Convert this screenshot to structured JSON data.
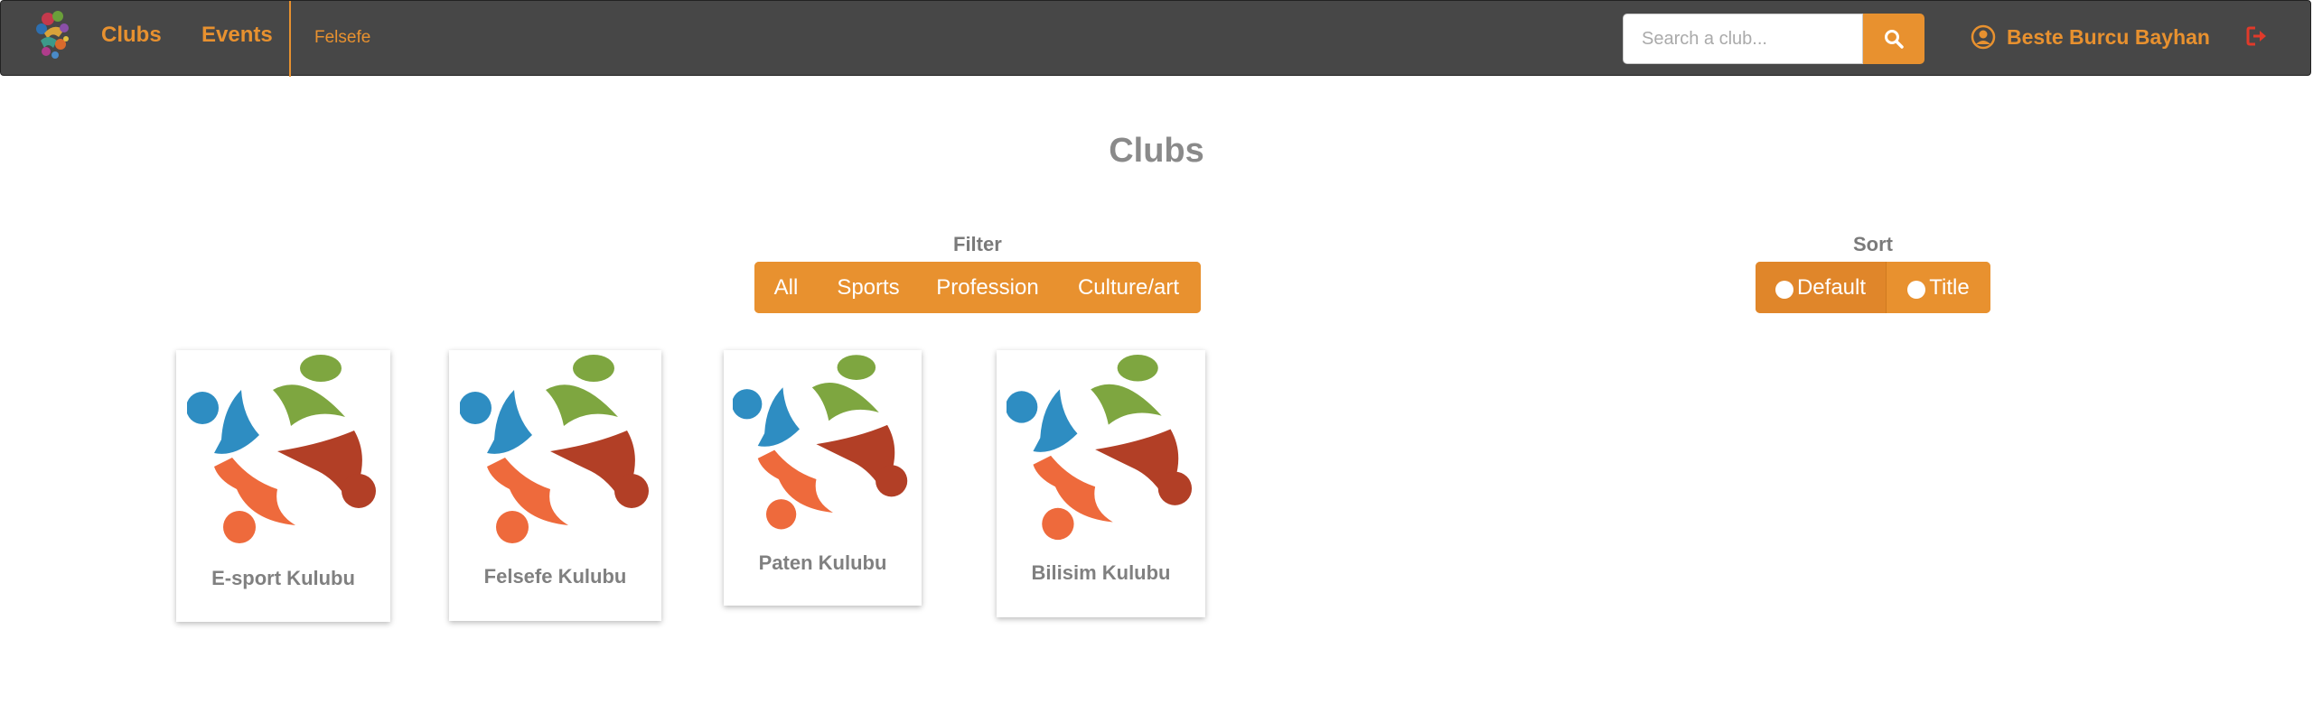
{
  "navbar": {
    "links": {
      "clubs": "Clubs",
      "events": "Events",
      "current": "Felsefe"
    },
    "search": {
      "placeholder": "Search a club..."
    },
    "user": {
      "name": "Beste Burcu Bayhan"
    },
    "icons": {
      "search": "search-icon",
      "user": "user-circle-icon",
      "logout": "logout-icon"
    },
    "accent_color": "#e8912f"
  },
  "main": {
    "title": "Clubs",
    "filter": {
      "label": "Filter",
      "options": [
        "All",
        "Sports",
        "Profession",
        "Culture/art"
      ]
    },
    "sort": {
      "label": "Sort",
      "options": [
        "Default",
        "Title"
      ],
      "selected": "Default"
    }
  },
  "clubs": [
    {
      "name": "E-sport Kulubu"
    },
    {
      "name": "Felsefe Kulubu"
    },
    {
      "name": "Paten Kulubu"
    },
    {
      "name": "Bilisim Kulubu"
    }
  ]
}
